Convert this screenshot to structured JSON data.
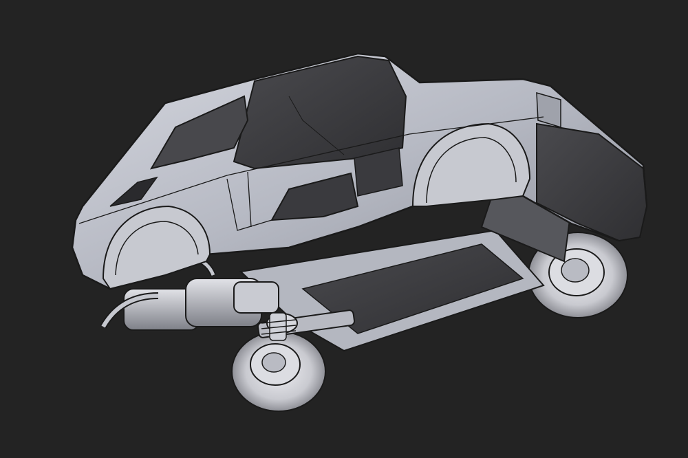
{
  "scene": {
    "subject": "car-body-exploded-chassis-render",
    "background_color": "#232323",
    "body_color": "#b9bcc6",
    "body_shade_color": "#8c8f99",
    "panel_dark_color": "#3d3d40",
    "outline_color": "#1a1a1a",
    "tire_color": "#d2d3d8"
  }
}
